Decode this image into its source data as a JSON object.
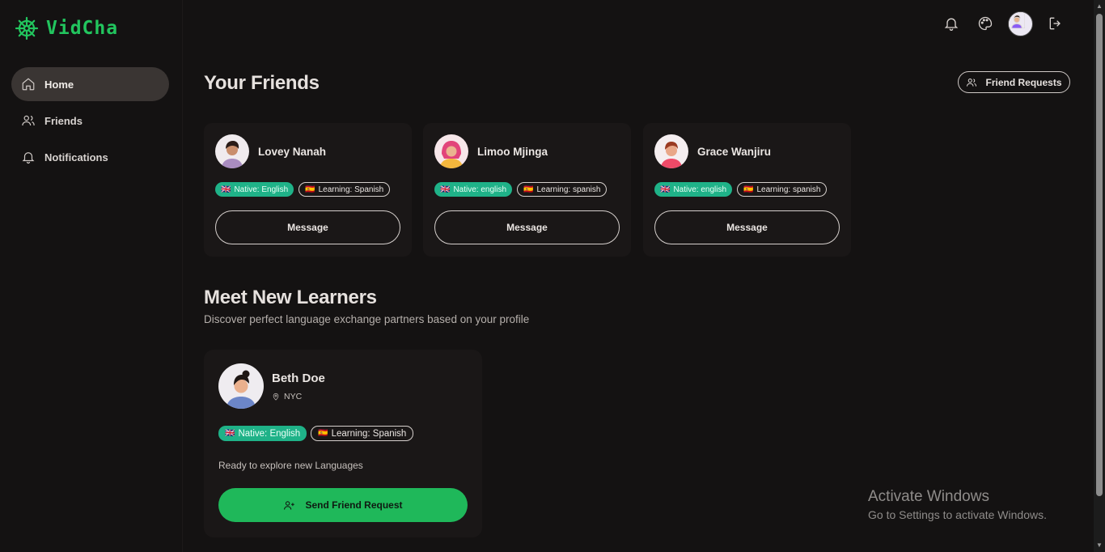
{
  "app": {
    "logo_text": "VidCha",
    "brand_color": "#22c55e"
  },
  "sidebar": {
    "items": [
      {
        "label": "Home",
        "icon": "home-icon",
        "active": true
      },
      {
        "label": "Friends",
        "icon": "users-icon",
        "active": false
      },
      {
        "label": "Notifications",
        "icon": "bell-icon",
        "active": false
      }
    ]
  },
  "topbar": {
    "icons": [
      "bell-icon",
      "palette-icon",
      "avatar",
      "logout-icon"
    ]
  },
  "friends_section": {
    "title": "Your Friends",
    "requests_button": "Friend Requests",
    "friends": [
      {
        "name": "Lovey Nanah",
        "native": "Native: English",
        "learning": "Learning: Spanish",
        "button": "Message"
      },
      {
        "name": "Limoo Mjinga",
        "native": "Native: english",
        "learning": "Learning: spanish",
        "button": "Message"
      },
      {
        "name": "Grace Wanjiru",
        "native": "Native: english",
        "learning": "Learning: spanish",
        "button": "Message"
      }
    ]
  },
  "learners_section": {
    "title": "Meet New Learners",
    "subtitle": "Discover perfect language exchange partners based on your profile",
    "learner": {
      "name": "Beth Doe",
      "location": "NYC",
      "native": "Native: English",
      "learning": "Learning: Spanish",
      "bio": "Ready to explore new Languages",
      "button": "Send Friend Request"
    }
  },
  "flags": {
    "english": "🇬🇧",
    "spanish": "🇪🇸"
  },
  "watermark": {
    "title": "Activate Windows",
    "subtitle": "Go to Settings to activate Windows."
  },
  "colors": {
    "background": "#141212",
    "card": "#1a1717",
    "native_badge": "#1fb288",
    "send_button": "#1fb85a"
  }
}
